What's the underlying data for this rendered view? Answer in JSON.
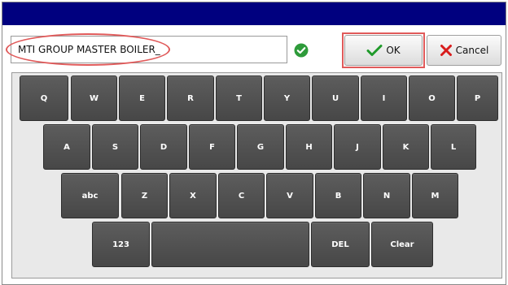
{
  "input": {
    "value": "MTI GROUP MASTER BOILER_"
  },
  "icons": {
    "valid": "check-circle-icon",
    "ok": "check-icon",
    "cancel": "x-icon"
  },
  "buttons": {
    "ok_label": "OK",
    "cancel_label": "Cancel"
  },
  "keyboard": {
    "row1": [
      "Q",
      "W",
      "E",
      "R",
      "T",
      "Y",
      "U",
      "I",
      "O",
      "P"
    ],
    "row2": [
      "A",
      "S",
      "D",
      "F",
      "G",
      "H",
      "J",
      "K",
      "L"
    ],
    "row3": [
      "abc",
      "Z",
      "X",
      "C",
      "V",
      "B",
      "N",
      "M"
    ],
    "row4": [
      "123",
      "",
      "DEL",
      "Clear"
    ]
  },
  "colors": {
    "titlebar": "#00007f",
    "key": "#4f4f4f",
    "valid_green": "#2e9b3a",
    "highlight": "#e05a5a",
    "cancel_red": "#d81c1c"
  }
}
